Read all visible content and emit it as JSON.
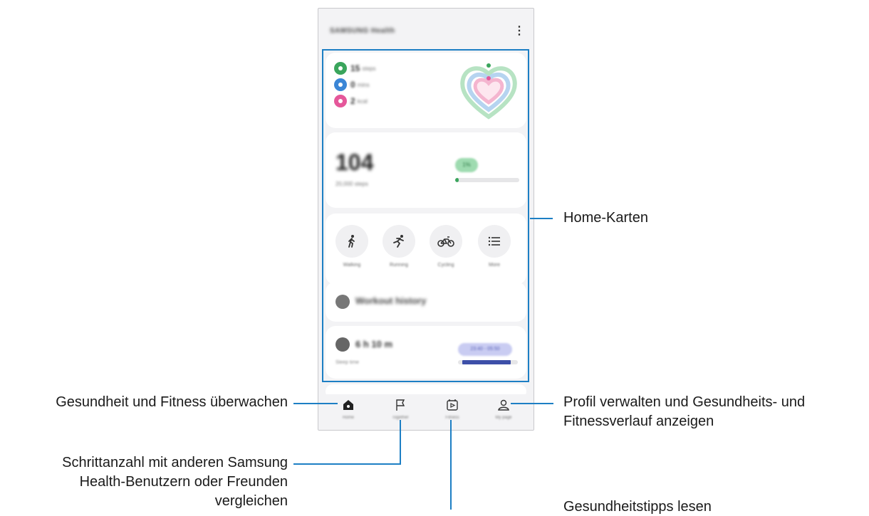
{
  "app": {
    "title": "SAMSUNG Health",
    "menu_icon": "kebab-menu-icon"
  },
  "activity": {
    "metrics": [
      {
        "icon": "steps-icon",
        "value": "15",
        "unit": "steps",
        "color": "#3aa55c"
      },
      {
        "icon": "clock-icon",
        "value": "0",
        "unit": "mins",
        "color": "#3b86d6"
      },
      {
        "icon": "flame-icon",
        "value": "2",
        "unit": "kcal",
        "color": "#e5579a"
      }
    ]
  },
  "steps": {
    "count": "104",
    "target": "20,000 steps",
    "percent_label": "1%",
    "progress": 0.05,
    "accent": "#3aa55c"
  },
  "workouts": [
    {
      "label": "Walking",
      "icon": "walking-icon"
    },
    {
      "label": "Running",
      "icon": "running-icon"
    },
    {
      "label": "Cycling",
      "icon": "cycling-icon"
    },
    {
      "label": "More",
      "icon": "list-icon"
    }
  ],
  "history": {
    "label": "Workout history",
    "icon": "stopwatch-icon"
  },
  "sleep": {
    "value": "6 h 10 m",
    "label": "Sleep time",
    "range": "23:40 - 05:50",
    "icon": "moon-icon",
    "accent": "#3d4fa8"
  },
  "nav": [
    {
      "label": "Home",
      "icon": "home-icon"
    },
    {
      "label": "Together",
      "icon": "flag-icon"
    },
    {
      "label": "Fitness",
      "icon": "play-calendar-icon"
    },
    {
      "label": "My page",
      "icon": "person-icon"
    }
  ],
  "callouts": {
    "home_cards": "Home-Karten",
    "monitor": "Gesundheit und Fitness überwachen",
    "profile_line1": "Profil verwalten und Gesundheits- und",
    "profile_line2": "Fitnessverlauf anzeigen",
    "steps_line1": "Schrittanzahl mit anderen Samsung",
    "steps_line2": "Health-Benutzern oder Freunden",
    "steps_line3": "vergleichen",
    "tips": "Gesundheitstipps lesen"
  },
  "highlight_color": "#1d7fc4"
}
